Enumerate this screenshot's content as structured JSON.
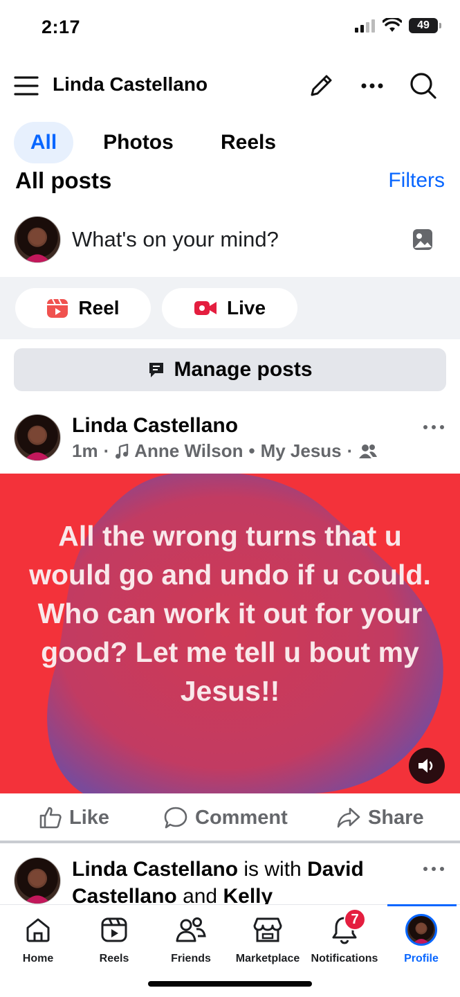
{
  "status": {
    "time": "2:17",
    "battery": "49"
  },
  "header": {
    "title": "Linda Castellano"
  },
  "tabs": [
    {
      "label": "All"
    },
    {
      "label": "Photos"
    },
    {
      "label": "Reels"
    }
  ],
  "section": {
    "title": "All posts",
    "filters_label": "Filters"
  },
  "composer": {
    "placeholder": "What's on your mind?"
  },
  "create": {
    "reel_label": "Reel",
    "live_label": "Live"
  },
  "manage_posts_label": "Manage posts",
  "post": {
    "author": "Linda Castellano",
    "time": "1m",
    "music_artist": "Anne Wilson",
    "music_song": "My Jesus",
    "text": "All the wrong turns that u would go and undo if u could. Who can work it out for your good? Let me tell u bout my Jesus!!",
    "actions": {
      "like": "Like",
      "comment": "Comment",
      "share": "Share"
    }
  },
  "post2": {
    "author": "Linda Castellano",
    "connector": "is with",
    "tagged1": "David Castellano",
    "connector2": "and",
    "tagged2": "Kelly"
  },
  "bottom_nav": {
    "home": "Home",
    "reels": "Reels",
    "friends": "Friends",
    "marketplace": "Marketplace",
    "notifications": "Notifications",
    "notifications_count": "7",
    "profile": "Profile"
  },
  "colors": {
    "accent": "#0866ff",
    "post_bg": "#f3323a",
    "badge": "#e41e3f"
  }
}
